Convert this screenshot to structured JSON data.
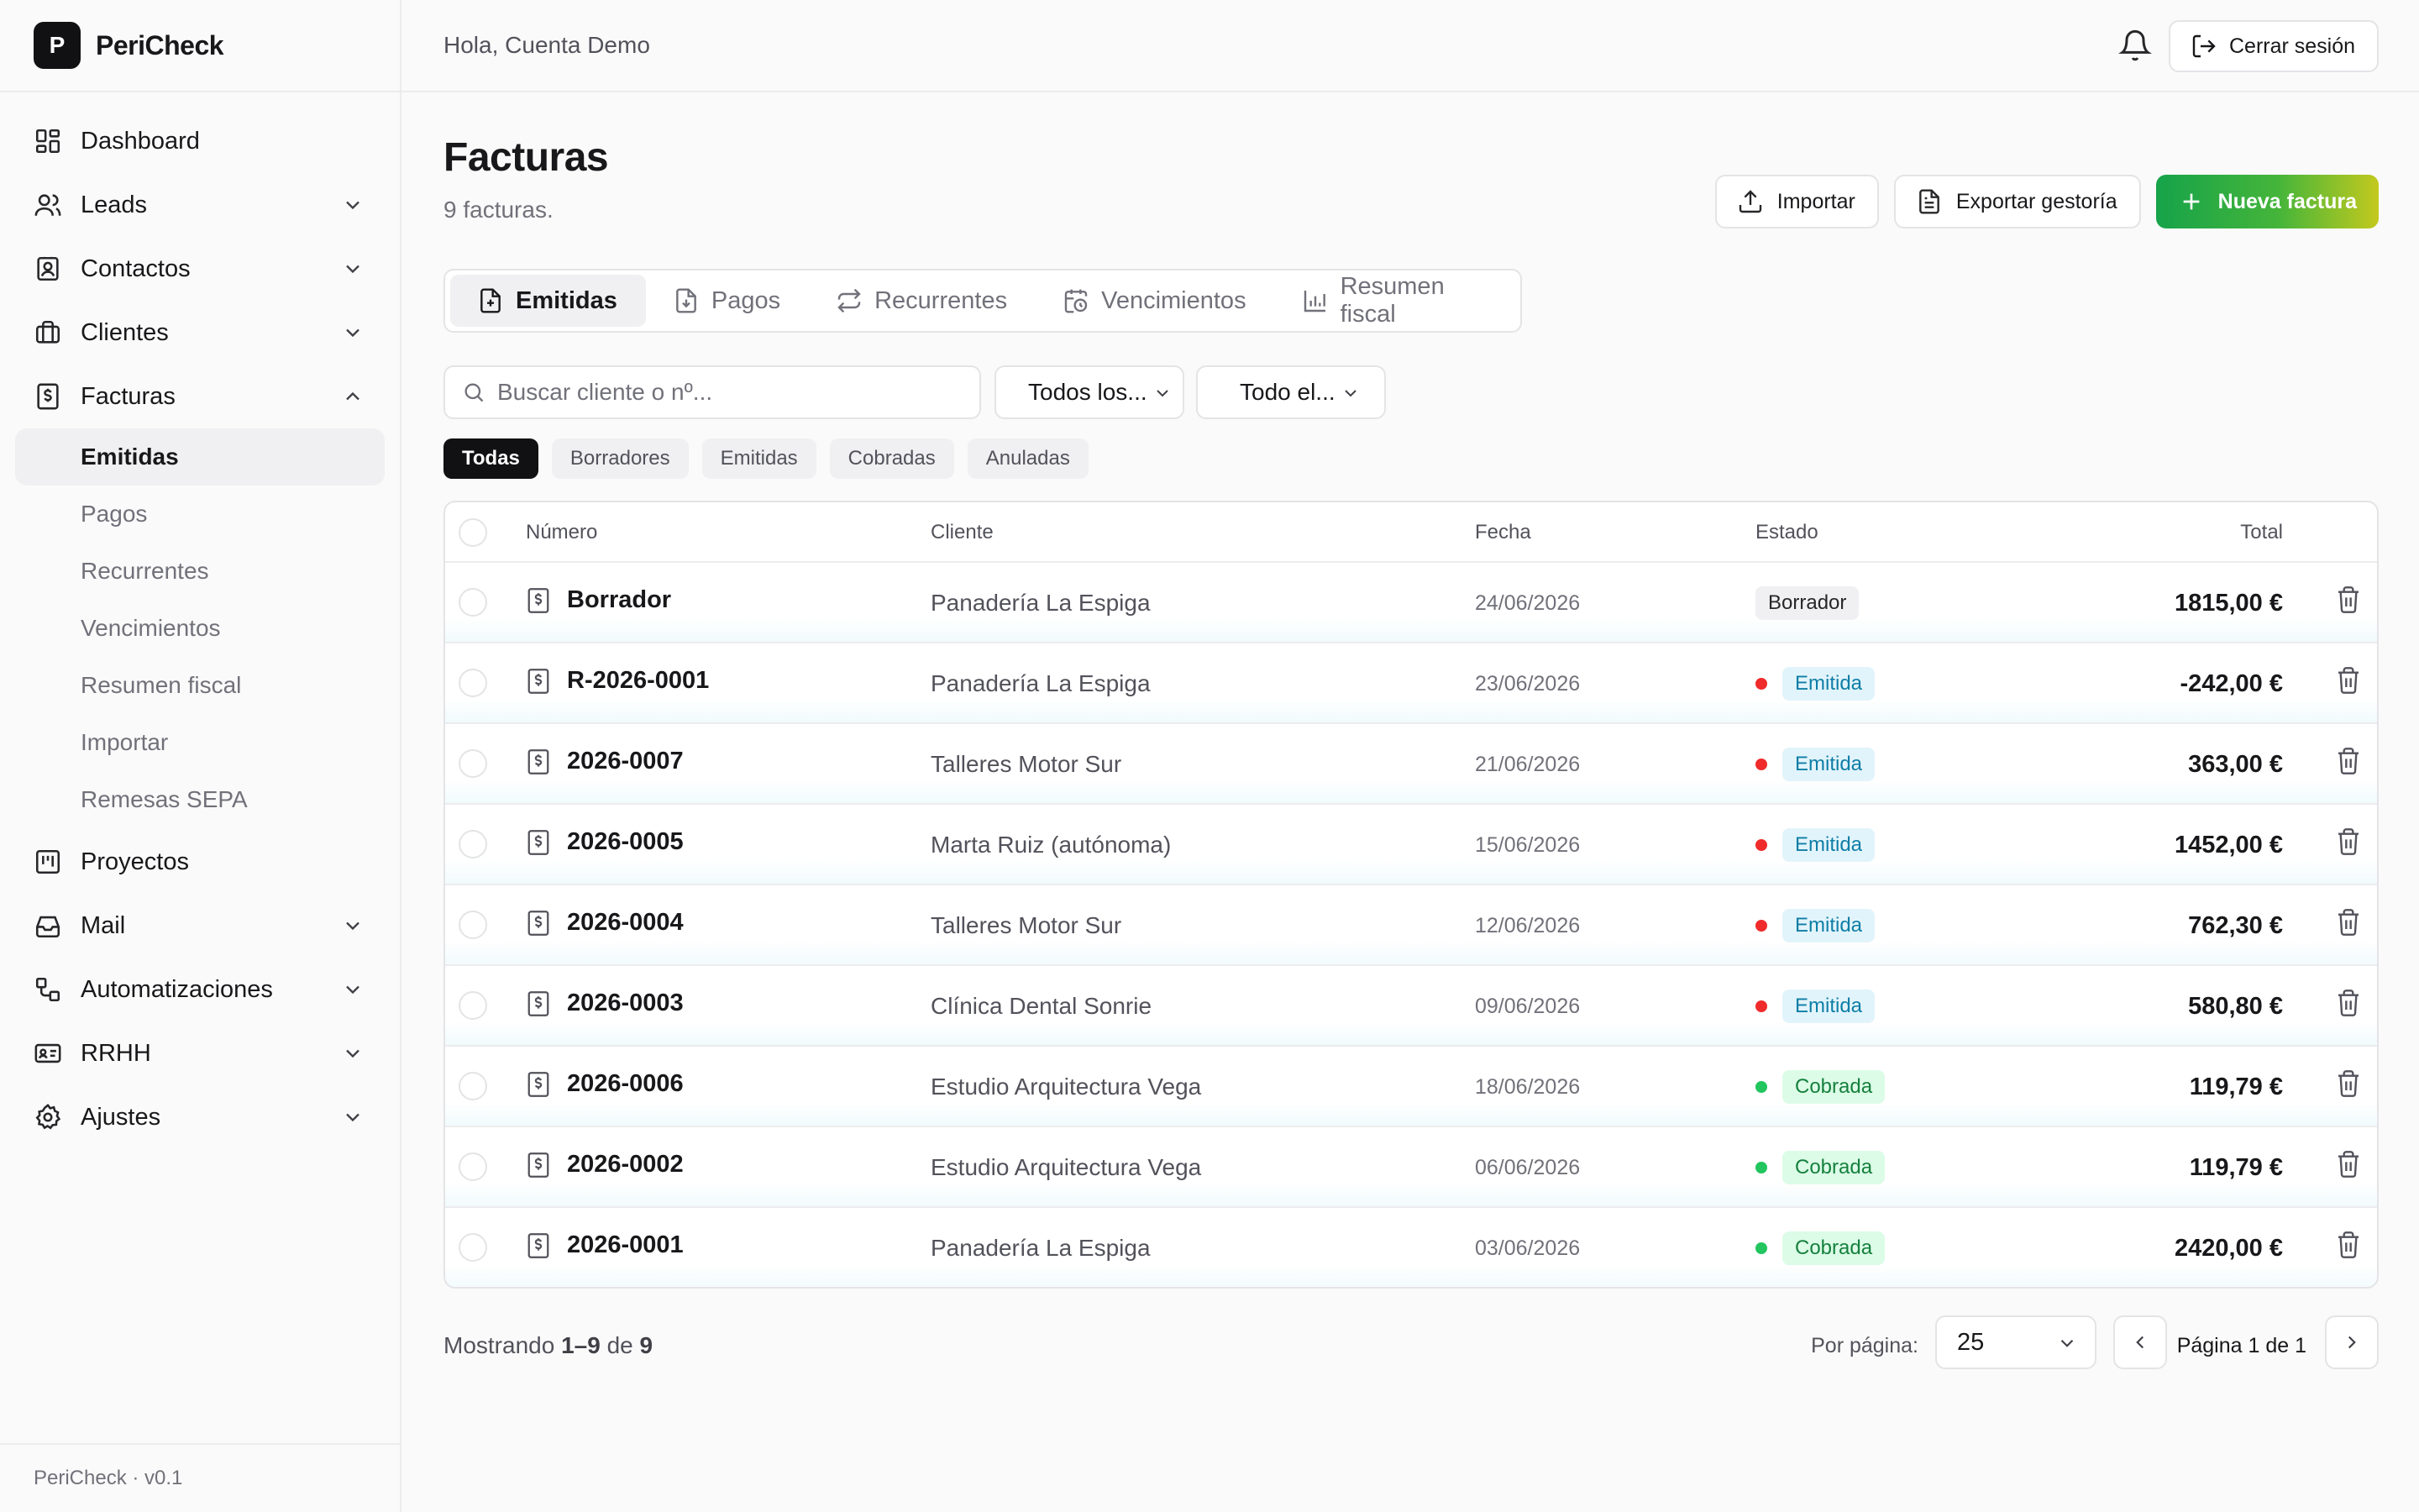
{
  "app": {
    "name": "PeriCheck",
    "logo_letter": "P",
    "version": "PeriCheck · v0.1"
  },
  "header": {
    "greeting": "Hola, Cuenta Demo",
    "logout_label": "Cerrar sesión"
  },
  "sidebar": {
    "items": [
      {
        "label": "Dashboard",
        "icon": "dashboard-icon"
      },
      {
        "label": "Leads",
        "icon": "users-icon"
      },
      {
        "label": "Contactos",
        "icon": "contacts-icon"
      },
      {
        "label": "Clientes",
        "icon": "briefcase-icon"
      },
      {
        "label": "Facturas",
        "icon": "invoice-icon"
      },
      {
        "label": "Proyectos",
        "icon": "kanban-icon"
      },
      {
        "label": "Mail",
        "icon": "inbox-icon"
      },
      {
        "label": "Automatizaciones",
        "icon": "workflow-icon"
      },
      {
        "label": "RRHH",
        "icon": "id-card-icon"
      },
      {
        "label": "Ajustes",
        "icon": "gear-icon"
      }
    ],
    "facturas_sub": [
      "Emitidas",
      "Pagos",
      "Recurrentes",
      "Vencimientos",
      "Resumen fiscal",
      "Importar",
      "Remesas SEPA"
    ]
  },
  "page": {
    "title": "Facturas",
    "subtitle": "9 facturas.",
    "actions": {
      "import": "Importar",
      "export": "Exportar gestoría",
      "new": "Nueva factura"
    }
  },
  "tabs": [
    "Emitidas",
    "Pagos",
    "Recurrentes",
    "Vencimientos",
    "Resumen fiscal"
  ],
  "filters": {
    "search_placeholder": "Buscar cliente o nº...",
    "select_1": "Todos los...",
    "select_2": "Todo el...",
    "pills": [
      "Todas",
      "Borradores",
      "Emitidas",
      "Cobradas",
      "Anuladas"
    ]
  },
  "table": {
    "columns": {
      "number": "Número",
      "client": "Cliente",
      "date": "Fecha",
      "status": "Estado",
      "total": "Total"
    },
    "rows": [
      {
        "number": "Borrador",
        "client": "Panadería La Espiga",
        "date": "24/06/2026",
        "status": "Borrador",
        "status_type": "draft",
        "total": "1815,00 €"
      },
      {
        "number": "R-2026-0001",
        "client": "Panadería La Espiga",
        "date": "23/06/2026",
        "status": "Emitida",
        "status_type": "issued",
        "total": "-242,00 €"
      },
      {
        "number": "2026-0007",
        "client": "Talleres Motor Sur",
        "date": "21/06/2026",
        "status": "Emitida",
        "status_type": "issued",
        "total": "363,00 €"
      },
      {
        "number": "2026-0005",
        "client": "Marta Ruiz (autónoma)",
        "date": "15/06/2026",
        "status": "Emitida",
        "status_type": "issued",
        "total": "1452,00 €"
      },
      {
        "number": "2026-0004",
        "client": "Talleres Motor Sur",
        "date": "12/06/2026",
        "status": "Emitida",
        "status_type": "issued",
        "total": "762,30 €"
      },
      {
        "number": "2026-0003",
        "client": "Clínica Dental Sonrie",
        "date": "09/06/2026",
        "status": "Emitida",
        "status_type": "issued",
        "total": "580,80 €"
      },
      {
        "number": "2026-0006",
        "client": "Estudio Arquitectura Vega",
        "date": "18/06/2026",
        "status": "Cobrada",
        "status_type": "paid",
        "total": "119,79 €"
      },
      {
        "number": "2026-0002",
        "client": "Estudio Arquitectura Vega",
        "date": "06/06/2026",
        "status": "Cobrada",
        "status_type": "paid",
        "total": "119,79 €"
      },
      {
        "number": "2026-0001",
        "client": "Panadería La Espiga",
        "date": "03/06/2026",
        "status": "Cobrada",
        "status_type": "paid",
        "total": "2420,00 €"
      }
    ]
  },
  "pagination": {
    "showing_prefix": "Mostrando",
    "showing_range": "1–9",
    "showing_of": "de",
    "showing_total": "9",
    "per_page_label": "Por página:",
    "per_page_value": "25",
    "page_label": "Página 1 de 1"
  },
  "colors": {
    "issued_dot": "#ef2b2b",
    "paid_dot": "#22c55e",
    "accent_start": "#16a34a",
    "accent_end": "#c3c91e"
  }
}
